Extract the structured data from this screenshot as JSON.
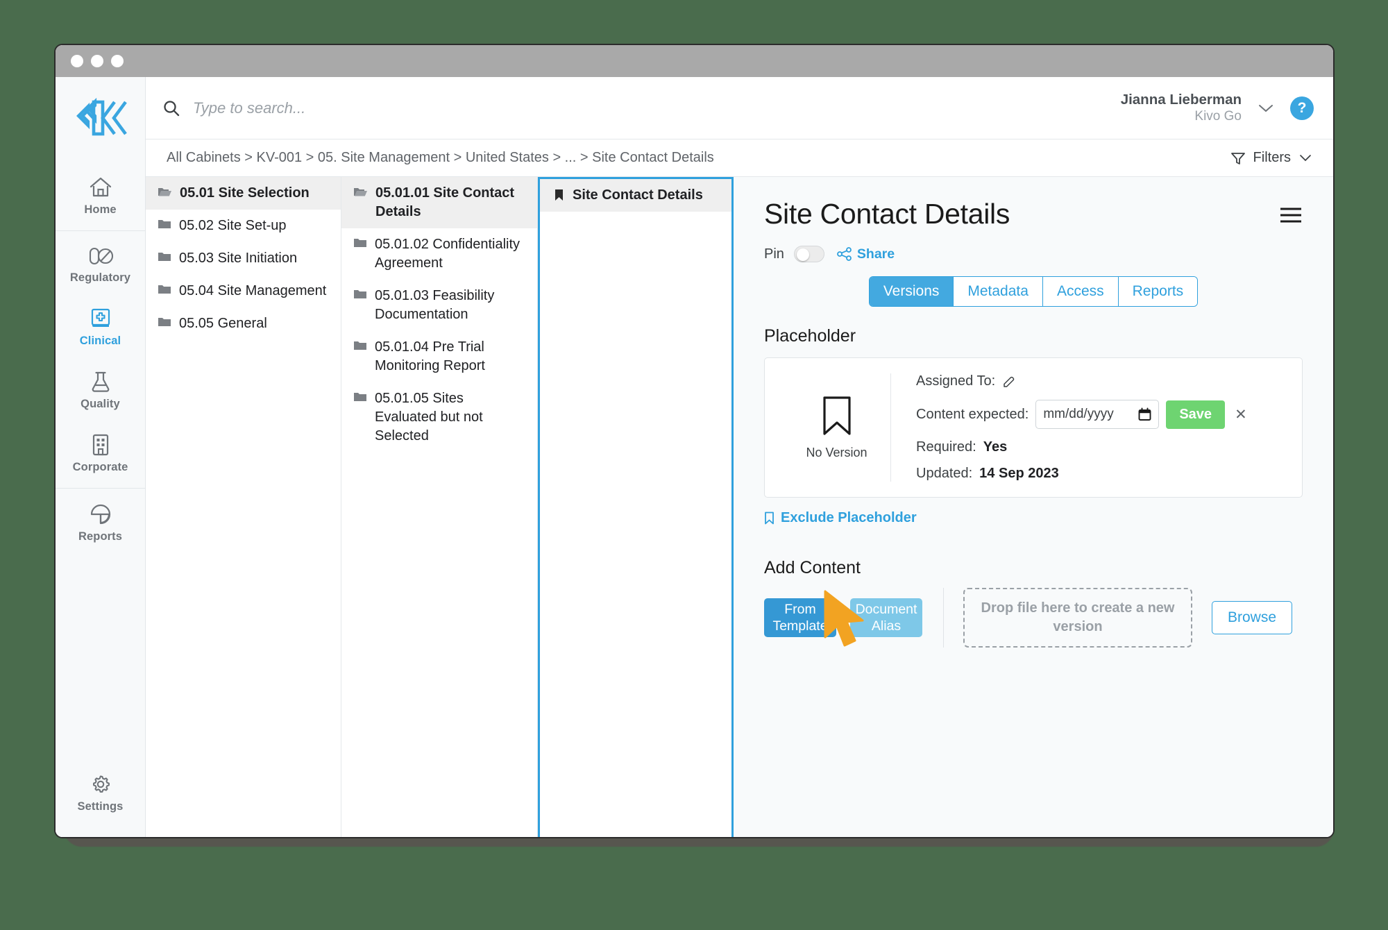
{
  "window": {
    "traffic_lights": [
      "close",
      "minimize",
      "maximize"
    ]
  },
  "brand": {
    "logo_name": "kivo-logo",
    "logo_color": "#3aa6e0"
  },
  "rail": {
    "groups": [
      {
        "items": [
          {
            "id": "home",
            "label": "Home",
            "icon": "home-icon",
            "active": false
          }
        ]
      },
      {
        "items": [
          {
            "id": "regulatory",
            "label": "Regulatory",
            "icon": "pill-icon",
            "active": false
          },
          {
            "id": "clinical",
            "label": "Clinical",
            "icon": "clinical-book-icon",
            "active": true
          },
          {
            "id": "quality",
            "label": "Quality",
            "icon": "flask-icon",
            "active": false
          },
          {
            "id": "corporate",
            "label": "Corporate",
            "icon": "building-icon",
            "active": false
          }
        ]
      },
      {
        "items": [
          {
            "id": "reports",
            "label": "Reports",
            "icon": "pie-chart-icon",
            "active": false
          }
        ]
      }
    ],
    "settings": {
      "id": "settings",
      "label": "Settings",
      "icon": "gear-icon"
    }
  },
  "topbar": {
    "search": {
      "placeholder": "Type to search...",
      "value": "",
      "icon": "search-icon"
    },
    "user": {
      "name": "Jianna Lieberman",
      "org": "Kivo Go",
      "chevron": "chevron-down-icon"
    },
    "help": {
      "label": "?",
      "icon": "help-icon",
      "color": "#3aa6e0"
    }
  },
  "crumbbar": {
    "breadcrumb": "All Cabinets > KV-001 > 05. Site Management > United States > ... > Site Contact Details",
    "filters": {
      "label": "Filters",
      "icon": "funnel-icon",
      "chevron": "chevron-down-icon"
    }
  },
  "tree": {
    "column1": [
      {
        "label": "05.01 Site Selection",
        "icon": "folder-open-icon",
        "selected": true
      },
      {
        "label": "05.02 Site Set-up",
        "icon": "folder-icon",
        "selected": false
      },
      {
        "label": "05.03 Site Initiation",
        "icon": "folder-icon",
        "selected": false
      },
      {
        "label": "05.04 Site Management",
        "icon": "folder-icon",
        "selected": false
      },
      {
        "label": "05.05 General",
        "icon": "folder-icon",
        "selected": false
      }
    ],
    "column2": [
      {
        "label": "05.01.01 Site Contact Details",
        "icon": "folder-open-icon",
        "selected": true
      },
      {
        "label": "05.01.02 Confidentiality Agreement",
        "icon": "folder-icon",
        "selected": false
      },
      {
        "label": "05.01.03 Feasibility Documentation",
        "icon": "folder-icon",
        "selected": false
      },
      {
        "label": "05.01.04 Pre Trial Monitoring Report",
        "icon": "folder-icon",
        "selected": false
      },
      {
        "label": "05.01.05 Sites Evaluated but not Selected",
        "icon": "folder-icon",
        "selected": false
      }
    ],
    "column3": [
      {
        "label": "Site Contact Details",
        "icon": "bookmark-icon",
        "selected": true
      }
    ]
  },
  "detail": {
    "title": "Site Contact Details",
    "menu_icon": "hamburger-menu-icon",
    "pin": {
      "label": "Pin",
      "on": false
    },
    "share": {
      "label": "Share",
      "icon": "share-icon"
    },
    "tabs": [
      {
        "label": "Versions",
        "active": true
      },
      {
        "label": "Metadata",
        "active": false
      },
      {
        "label": "Access",
        "active": false
      },
      {
        "label": "Reports",
        "active": false
      }
    ],
    "placeholder": {
      "section_title": "Placeholder",
      "thumb_icon": "bookmark-outline-icon",
      "no_version_label": "No Version",
      "assigned_to_label": "Assigned To:",
      "assigned_to_value": "",
      "edit_icon": "pencil-edit-icon",
      "content_expected_label": "Content expected:",
      "date_placeholder": "mm/dd/yyyy",
      "date_value": "",
      "calendar_icon": "calendar-icon",
      "save_label": "Save",
      "clear_icon": "close-x-icon",
      "required_label": "Required:",
      "required_value": "Yes",
      "updated_label": "Updated:",
      "updated_value": "14 Sep 2023",
      "exclude_label": "Exclude Placeholder",
      "exclude_icon": "bookmark-outline-icon"
    },
    "add_content": {
      "section_title": "Add Content",
      "from_template_label": "From Template",
      "document_alias_label": "Document Alias",
      "dropzone_label": "Drop file here to create a new version",
      "browse_label": "Browse"
    }
  },
  "colors": {
    "accent_blue": "#2fa0dd",
    "button_blue": "#3598d4",
    "button_blue_light": "#7ec8e8",
    "save_green": "#6ed471",
    "cursor_orange": "#f2a322",
    "desktop": "#4a6c4d"
  },
  "cursor": {
    "icon": "mouse-pointer-icon",
    "color": "#f2a322"
  }
}
